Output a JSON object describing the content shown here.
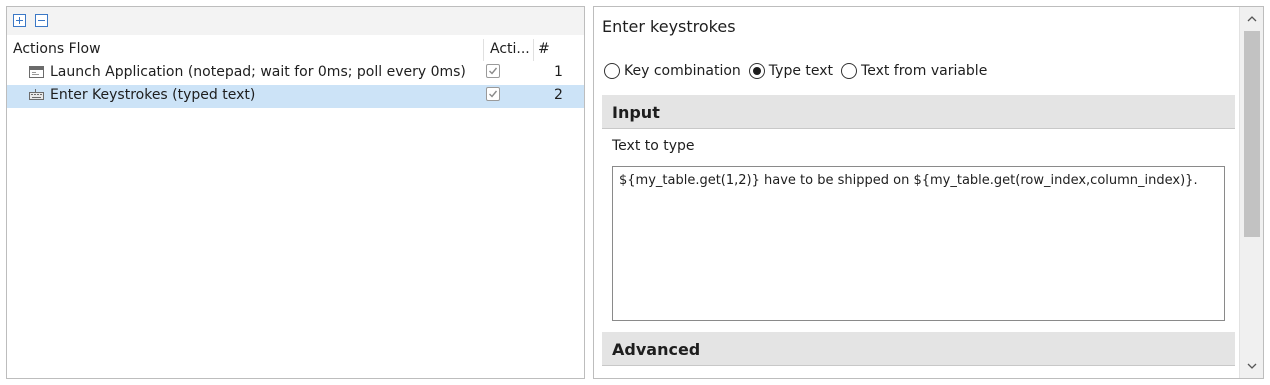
{
  "toolbar": {
    "expand_icon": "expand-all-icon",
    "collapse_icon": "collapse-all-icon"
  },
  "tree": {
    "columns": [
      "Actions Flow",
      "Acti...",
      "#"
    ],
    "rows": [
      {
        "icon": "application-window-icon",
        "label": "Launch Application (notepad; wait for 0ms; poll every 0ms)",
        "active": true,
        "number": "1",
        "selected": false
      },
      {
        "icon": "keyboard-icon",
        "label": "Enter Keystrokes (typed text)",
        "active": true,
        "number": "2",
        "selected": true
      }
    ]
  },
  "properties": {
    "title": "Enter keystrokes",
    "mode_options": [
      {
        "label": "Key combination",
        "checked": false
      },
      {
        "label": "Type text",
        "checked": true
      },
      {
        "label": "Text from variable",
        "checked": false
      }
    ],
    "input_section": "Input",
    "text_label": "Text to type",
    "text_value": "${my_table.get(1,2)} have to be shipped on ${my_table.get(row_index,column_index)}.",
    "advanced_section": "Advanced"
  },
  "colors": {
    "selection": "#cce3f7",
    "section_header": "#e4e4e4",
    "accent": "#3b78c6"
  }
}
